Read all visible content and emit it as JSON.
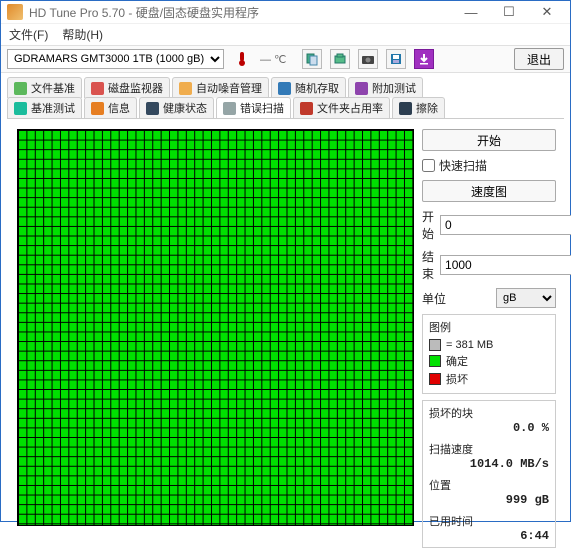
{
  "window": {
    "title": "HD Tune Pro 5.70 - 硬盘/固态硬盘实用程序"
  },
  "menu": {
    "file": "文件(F)",
    "help": "帮助(H)"
  },
  "toolbar": {
    "drive": "GDRAMARS  GMT3000 1TB (1000 gB)",
    "temp": "— ℃",
    "exit": "退出"
  },
  "tabs": {
    "row1": [
      "文件基准",
      "磁盘监视器",
      "自动噪音管理",
      "随机存取",
      "附加测试"
    ],
    "row2": [
      "基准测试",
      "信息",
      "健康状态",
      "错误扫描",
      "文件夹占用率",
      "擦除"
    ],
    "active": "错误扫描"
  },
  "controls": {
    "start": "开始",
    "quick_scan": "快速扫描",
    "speed_map": "速度图",
    "start_label": "开始",
    "start_value": "0",
    "end_label": "结束",
    "end_value": "1000",
    "unit_label": "单位",
    "unit_value": "gB"
  },
  "legend": {
    "title": "图例",
    "block_size": "= 381 MB",
    "ok": "确定",
    "damaged": "损坏"
  },
  "stats": {
    "damaged_blocks_label": "损坏的块",
    "damaged_blocks_value": "0.0 %",
    "scan_speed_label": "扫描速度",
    "scan_speed_value": "1014.0 MB/s",
    "position_label": "位置",
    "position_value": "999 gB",
    "elapsed_label": "已用时间",
    "elapsed_value": "6:44"
  }
}
